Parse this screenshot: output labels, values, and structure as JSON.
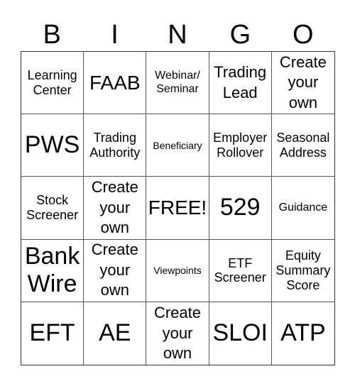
{
  "header": {
    "letters": [
      "B",
      "I",
      "N",
      "G",
      "O"
    ]
  },
  "cells": [
    {
      "text": "Learning Center",
      "size": "s-sm"
    },
    {
      "text": "FAAB",
      "size": "s-l"
    },
    {
      "text": "Webinar/ Seminar",
      "size": "s-s"
    },
    {
      "text": "Trading Lead",
      "size": "s-m"
    },
    {
      "text": "Create your own",
      "size": "s-m"
    },
    {
      "text": "PWS",
      "size": "s-xl"
    },
    {
      "text": "Trading Authority",
      "size": "s-sm"
    },
    {
      "text": "Beneficiary",
      "size": "s-xs"
    },
    {
      "text": "Employer Rollover",
      "size": "s-sm"
    },
    {
      "text": "Seasonal Address",
      "size": "s-sm"
    },
    {
      "text": "Stock Screener",
      "size": "s-sm"
    },
    {
      "text": "Create your own",
      "size": "s-m"
    },
    {
      "text": "FREE!",
      "size": "s-l"
    },
    {
      "text": "529",
      "size": "s-xl"
    },
    {
      "text": "Guidance",
      "size": "s-s"
    },
    {
      "text": "Bank Wire",
      "size": "s-xl"
    },
    {
      "text": "Create your own",
      "size": "s-m"
    },
    {
      "text": "Viewpoints",
      "size": "s-xs"
    },
    {
      "text": "ETF Screener",
      "size": "s-sm"
    },
    {
      "text": "Equity Summary Score",
      "size": "s-sm"
    },
    {
      "text": "EFT",
      "size": "s-xl"
    },
    {
      "text": "AE",
      "size": "s-xl"
    },
    {
      "text": "Create your own",
      "size": "s-m"
    },
    {
      "text": "SLOI",
      "size": "s-xl"
    },
    {
      "text": "ATP",
      "size": "s-xl"
    }
  ]
}
